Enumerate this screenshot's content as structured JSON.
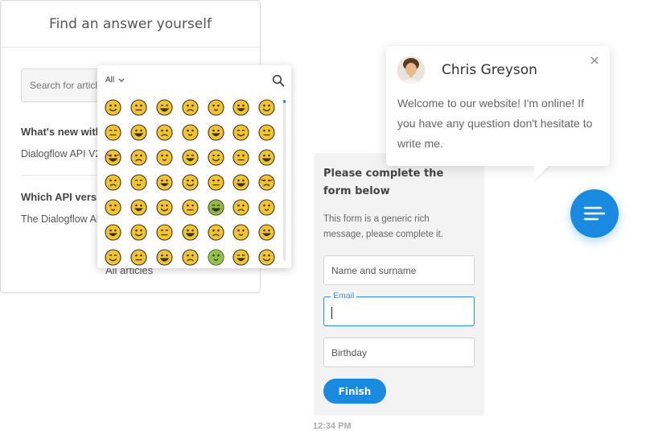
{
  "knowledge_base": {
    "title": "Find an answer yourself",
    "search_placeholder": "Search for articles...",
    "articles": [
      {
        "question": "What's new with Dialogflow API V2?",
        "answer": "Dialogflow API V2 is the new version..."
      },
      {
        "question": "Which API version should I use?",
        "answer": "The Dialogflow API V2 is recommended..."
      }
    ],
    "all_articles_label": "All articles"
  },
  "emoji_picker": {
    "category_label": "All",
    "icons": [
      "chevron-down-icon",
      "search-icon"
    ],
    "emoji_count": 49
  },
  "form": {
    "title": "Please complete the form below",
    "description": "This form is a generic rich message, please complete it.",
    "fields": [
      {
        "label": "Name and surname",
        "value": ""
      },
      {
        "label": "Email",
        "value": ""
      },
      {
        "label": "Birthday",
        "value": ""
      }
    ],
    "submit_label": "Finish",
    "timestamp": "12:34 PM"
  },
  "chat_bubble": {
    "agent_name": "Chris Greyson",
    "message": "Welcome to our website! I'm online! If you have any question don't hesitate to write me."
  },
  "colors": {
    "accent": "#1a8ae0",
    "emoji_face": "#f4c430",
    "emoji_outline": "#333333"
  }
}
